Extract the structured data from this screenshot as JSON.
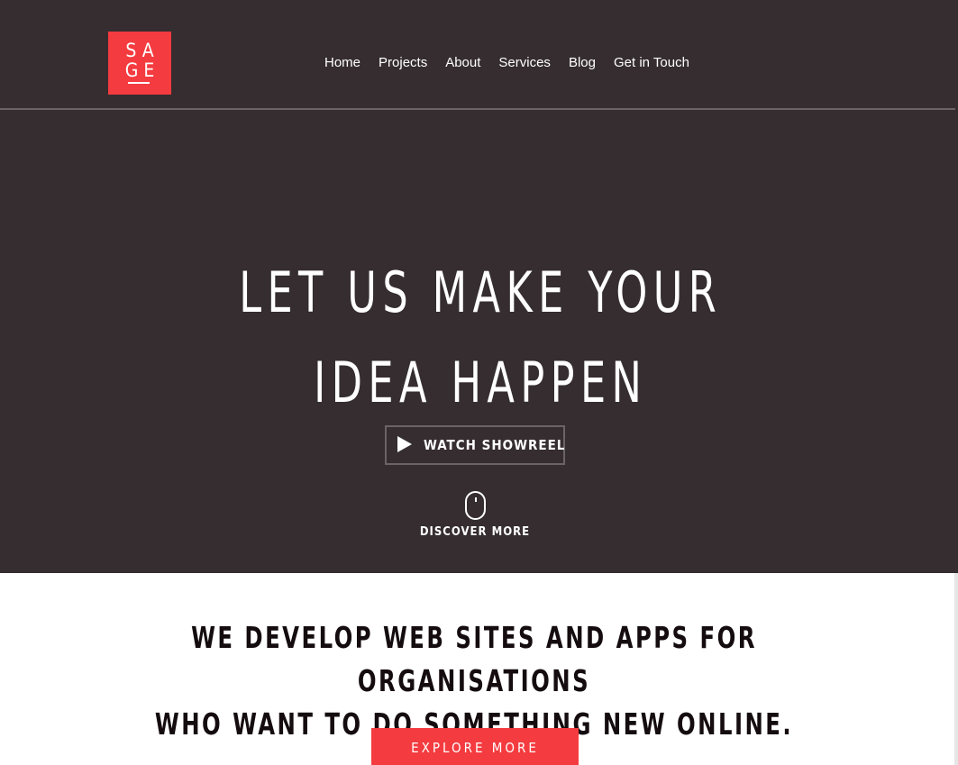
{
  "brand": {
    "logo_text": "SA\nGE",
    "accent_color": "#f43b3f",
    "dark_bg": "#352d30"
  },
  "nav": {
    "items": [
      {
        "label": "Home"
      },
      {
        "label": "Projects"
      },
      {
        "label": "About"
      },
      {
        "label": "Services"
      },
      {
        "label": "Blog"
      },
      {
        "label": "Get in Touch"
      }
    ]
  },
  "hero": {
    "title_line1": "LET US MAKE YOUR",
    "title_line2": "IDEA HAPPEN",
    "showreel_label": "WATCH SHOWREEL",
    "play_icon": "play-icon",
    "mouse_icon": "mouse-icon",
    "discover_label": "DISCOVER MORE"
  },
  "intro": {
    "line1": "WE DEVELOP WEB SITES AND APPS FOR ORGANISATIONS",
    "line2": "WHO WANT TO DO SOMETHING NEW ONLINE.",
    "cta_label": "EXPLORE MORE"
  }
}
